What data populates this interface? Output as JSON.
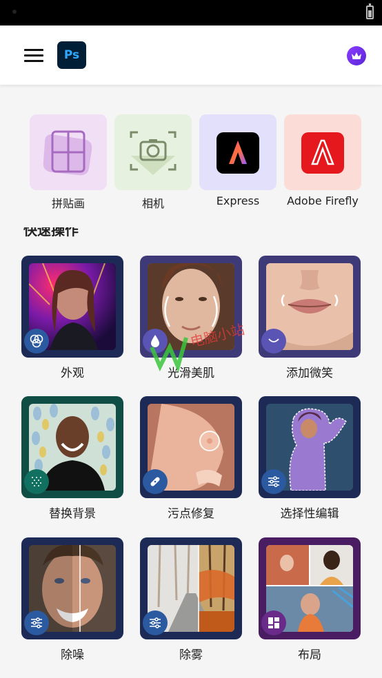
{
  "appbar": {
    "logo_text": "Ps",
    "menu_icon": "hamburger-menu-icon",
    "premium_icon": "crown-icon"
  },
  "tools": [
    {
      "label": "拼贴画",
      "icon": "collage-icon",
      "bg": "#f1dff5"
    },
    {
      "label": "相机",
      "icon": "camera-icon",
      "bg": "#e6f1df"
    },
    {
      "label": "Express",
      "icon": "adobe-express-icon",
      "bg": "#e3e0fb"
    },
    {
      "label": "Adobe Firefly",
      "icon": "adobe-firefly-icon",
      "bg": "#fbdcd6"
    }
  ],
  "section": {
    "title": "快速操作"
  },
  "actions": [
    {
      "label": "外观",
      "icon": "looks-icon",
      "frame": "#1c2a55"
    },
    {
      "label": "光滑美肌",
      "icon": "skin-drop-icon",
      "frame": "#3e3a78"
    },
    {
      "label": "添加微笑",
      "icon": "smile-icon",
      "frame": "#3e3a78"
    },
    {
      "label": "替换背景",
      "icon": "pattern-icon",
      "frame": "#104d45"
    },
    {
      "label": "污点修复",
      "icon": "bandage-icon",
      "frame": "#1c2a55"
    },
    {
      "label": "选择性编辑",
      "icon": "sliders-icon",
      "frame": "#1c2a55"
    },
    {
      "label": "除噪",
      "icon": "sliders-icon",
      "frame": "#1c2a55"
    },
    {
      "label": "除雾",
      "icon": "sliders-icon",
      "frame": "#1c2a55"
    },
    {
      "label": "布局",
      "icon": "layout-grid-icon",
      "frame": "#4a1d63"
    }
  ],
  "watermark": {
    "text": "电脑小站"
  },
  "colors": {
    "accent": "#31a8ff",
    "logo_bg": "#001e36",
    "premium": "#7a32f0"
  }
}
